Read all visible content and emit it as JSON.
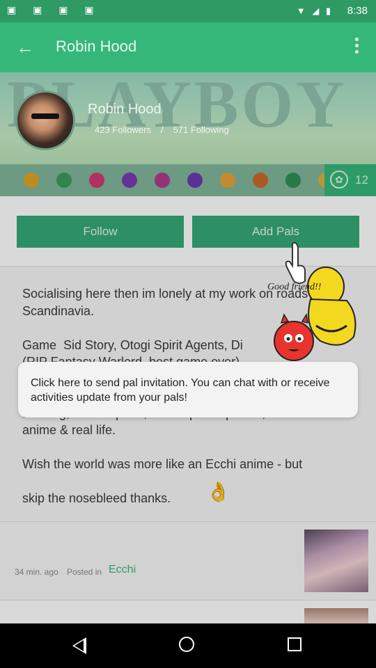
{
  "status_bar": {
    "time": "8:38"
  },
  "app_bar": {
    "title": "Robin Hood"
  },
  "cover": {
    "text": "PLAYBOY"
  },
  "profile": {
    "name": "Robin Hood",
    "followers": "423 Followers",
    "separator": "/",
    "following": "571 Following"
  },
  "badges": {
    "colors": [
      "#e0a42a",
      "#3c9a5a",
      "#d33a6f",
      "#7a3ab0",
      "#b03a8f",
      "#6a3ab0",
      "#e6a33a",
      "#c86a2a",
      "#2f8f53",
      "#d9b33a"
    ],
    "level": "12"
  },
  "actions": {
    "follow": "Follow",
    "add_pals": "Add Pals"
  },
  "bio": {
    "text": "Socialising here then im lonely at my work on roads in Scandinavia.\n\nGame  Sid Story, Otogi Spirit Agents, Di\n(RIP Fantasy Warlord, best game ever)\n\nLikes: Anime, Gaming, Cosplaying, Beer,\nBowling, Wintersports, Sex at public places, Ecchi\nanime & real life.\n\nWish the world was more like an Ecchi anime - but\n\nskip the nosebleed thanks."
  },
  "tooltip": {
    "message": "Click here to send pal invitation. You can chat with or receive activities update from your pals!",
    "mascot_caption": "Good friend!!"
  },
  "post": {
    "time": "34 min. ago",
    "posted_in": "Posted in",
    "category": "Ecchi"
  },
  "colors": {
    "accent": "#35b779",
    "status": "#2f9a63"
  }
}
